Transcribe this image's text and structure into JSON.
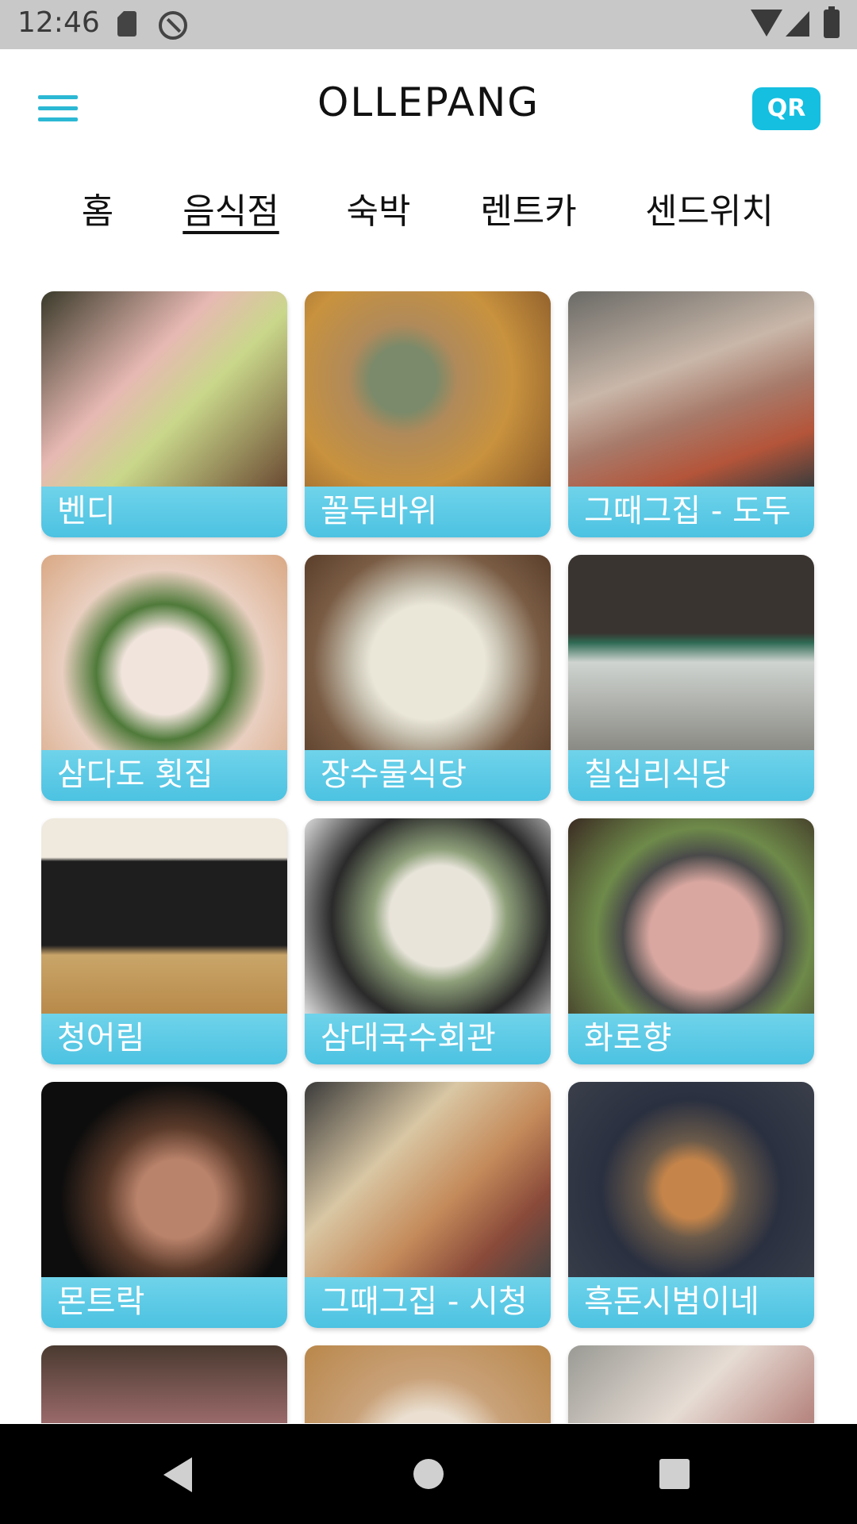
{
  "status_bar": {
    "time": "12:46"
  },
  "header": {
    "title": "OLLEPANG",
    "qr_label": "QR",
    "accent": "#14bfe0"
  },
  "tabs": [
    {
      "label": "홈",
      "active": false
    },
    {
      "label": "음식점",
      "active": true
    },
    {
      "label": "숙박",
      "active": false
    },
    {
      "label": "렌트카",
      "active": false
    },
    {
      "label": "센드위치",
      "active": false
    }
  ],
  "restaurants": [
    {
      "name": "벤디"
    },
    {
      "name": "꼴두바위"
    },
    {
      "name": "그때그집 - 도두"
    },
    {
      "name": "삼다도 횟집"
    },
    {
      "name": "장수물식당"
    },
    {
      "name": "칠십리식당"
    },
    {
      "name": "청어림"
    },
    {
      "name": "삼대국수회관"
    },
    {
      "name": "화로향"
    },
    {
      "name": "몬트락"
    },
    {
      "name": "그때그집 - 시청"
    },
    {
      "name": "흑돈시범이네"
    },
    {
      "name": ""
    },
    {
      "name": ""
    },
    {
      "name": ""
    }
  ],
  "label_color": "#4cc2e2"
}
